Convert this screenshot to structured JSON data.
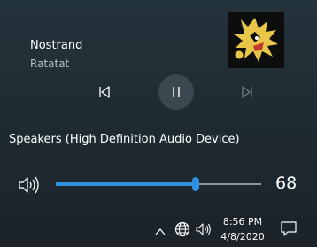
{
  "media": {
    "title": "Nostrand",
    "artist": "Ratatat",
    "controls": {
      "previous_icon": "previous-track-icon",
      "play_pause_icon": "pause-icon",
      "next_icon": "next-track-icon"
    }
  },
  "audio": {
    "device_name": "Speakers (High Definition Audio Device)",
    "volume_icon": "speaker-volume-icon",
    "volume": 68,
    "volume_label": "68"
  },
  "taskbar": {
    "time": "8:56 PM",
    "date": "4/8/2020",
    "icons": [
      "chevron-up-icon",
      "globe-icon",
      "volume-icon",
      "notification-icon"
    ]
  },
  "colors": {
    "accent": "#2f8fe0",
    "background": "#1f2a31",
    "taskbar": "#1c2429"
  }
}
